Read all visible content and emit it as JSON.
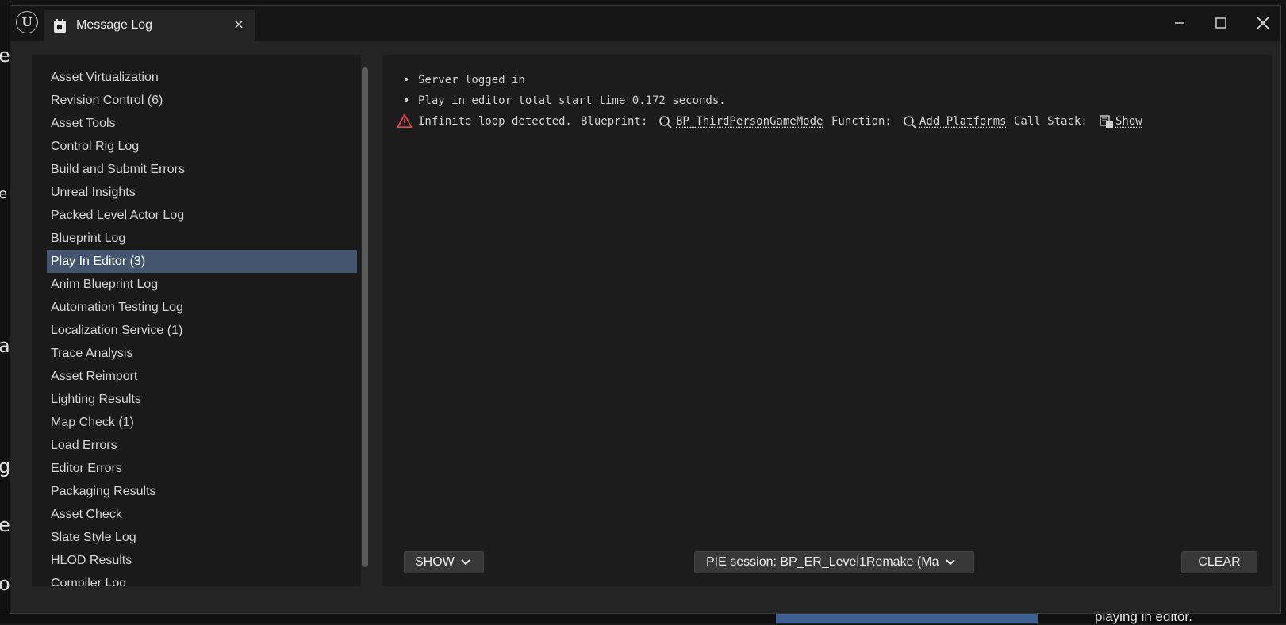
{
  "window": {
    "tab_title": "Message Log",
    "tab_close": "×"
  },
  "sidebar": {
    "items": [
      {
        "label": "Asset Virtualization"
      },
      {
        "label": "Revision Control (6)"
      },
      {
        "label": "Asset Tools"
      },
      {
        "label": "Control Rig Log"
      },
      {
        "label": "Build and Submit Errors"
      },
      {
        "label": "Unreal Insights"
      },
      {
        "label": "Packed Level Actor Log"
      },
      {
        "label": "Blueprint Log"
      },
      {
        "label": "Play In Editor (3)",
        "selected": true
      },
      {
        "label": "Anim Blueprint Log"
      },
      {
        "label": "Automation Testing Log"
      },
      {
        "label": "Localization Service (1)"
      },
      {
        "label": "Trace Analysis"
      },
      {
        "label": "Asset Reimport"
      },
      {
        "label": "Lighting Results"
      },
      {
        "label": "Map Check (1)"
      },
      {
        "label": "Load Errors"
      },
      {
        "label": "Editor Errors"
      },
      {
        "label": "Packaging Results"
      },
      {
        "label": "Asset Check"
      },
      {
        "label": "Slate Style Log"
      },
      {
        "label": "HLOD Results"
      },
      {
        "label": "Compiler Log"
      }
    ]
  },
  "log": {
    "messages": [
      {
        "text": "Server logged in"
      },
      {
        "text": "Play in editor total start time 0.172 seconds."
      }
    ],
    "warning": {
      "text": "Infinite loop detected.",
      "blueprint_label": "Blueprint:",
      "blueprint_link": "BP_ThirdPersonGameMode",
      "function_label": "Function:",
      "function_link": "Add Platforms",
      "callstack_label": "Call Stack:",
      "callstack_link": "Show"
    }
  },
  "footer": {
    "show_button": "SHOW",
    "session_dropdown": "PIE session: BP_ER_Level1Remake (Ma",
    "clear_button": "CLEAR"
  },
  "colors": {
    "selected_row": "#44566f",
    "warning": "#e04848",
    "panel_bg": "#1c1c1c",
    "window_bg": "#242424"
  },
  "background": {
    "left_edge_glyphs": [
      "e",
      "e",
      "a",
      "g",
      "et",
      "o"
    ],
    "right_bottom_text": "playing in editor."
  }
}
